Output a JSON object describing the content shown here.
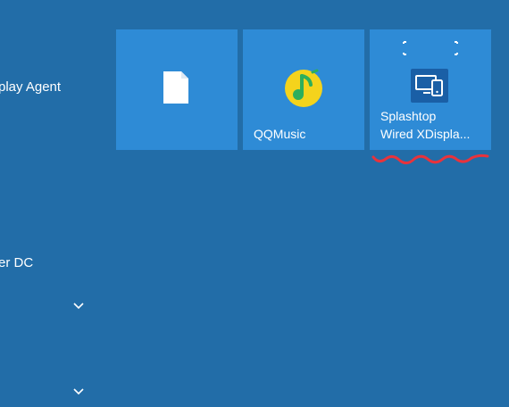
{
  "start_menu": {
    "app_list": [
      {
        "label": "play Agent",
        "icon": "none"
      },
      {
        "label": "er DC",
        "icon": "none"
      }
    ],
    "expand_icon": "chevron-down-icon",
    "tiles": [
      {
        "label": "",
        "icon": "document-icon"
      },
      {
        "label": "QQMusic",
        "icon": "qqmusic-icon"
      },
      {
        "label": "Splashtop\nWired XDispla...",
        "icon": "splashtop-wired-xdisplay-icon"
      }
    ]
  },
  "colors": {
    "background": "#226da8",
    "tile": "#2e8bd6",
    "qqmusic_yellow": "#f4d31c",
    "qqmusic_green": "#2dae5c",
    "annotation_red": "#e8333c"
  }
}
